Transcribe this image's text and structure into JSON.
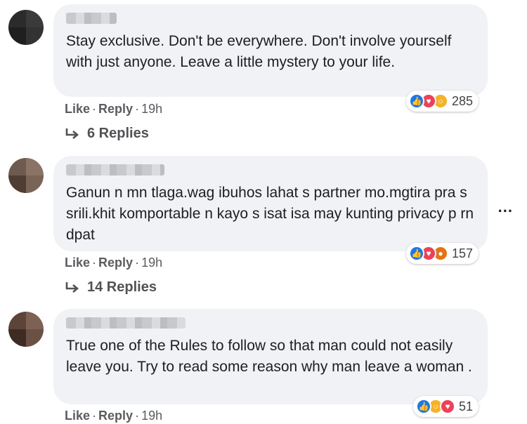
{
  "comments": [
    {
      "text": "Stay exclusive. Don't be everywhere. Don't involve yourself with just anyone. Leave a little mystery to your life.",
      "reactions": [
        "like-icon",
        "love-icon",
        "wow-icon"
      ],
      "reaction_count": "285",
      "actions": {
        "like": "Like",
        "reply": "Reply",
        "time": "19h"
      },
      "replies_label": "6 Replies"
    },
    {
      "text": "Ganun n mn tlaga.wag ibuhos lahat s partner mo.mgtira pra s srili.khit komportable n kayo s isat isa may kunting privacy p rn dpat",
      "reactions": [
        "like-icon",
        "love-icon",
        "angry-icon"
      ],
      "reaction_count": "157",
      "actions": {
        "like": "Like",
        "reply": "Reply",
        "time": "19h"
      },
      "replies_label": "14 Replies"
    },
    {
      "text": "True one of the Rules to follow so that man could not easily leave you. Try to read some reason why man leave a woman .",
      "reactions": [
        "like-icon",
        "wow-icon",
        "love-icon"
      ],
      "reaction_count": "51",
      "actions": {
        "like": "Like",
        "reply": "Reply",
        "time": "19h"
      }
    }
  ],
  "more_menu": "...",
  "colors": {
    "bubble": "#f0f2f5",
    "like": "#1877f2",
    "love": "#f33e58",
    "wow": "#f7b125",
    "angry": "#e9710f"
  }
}
